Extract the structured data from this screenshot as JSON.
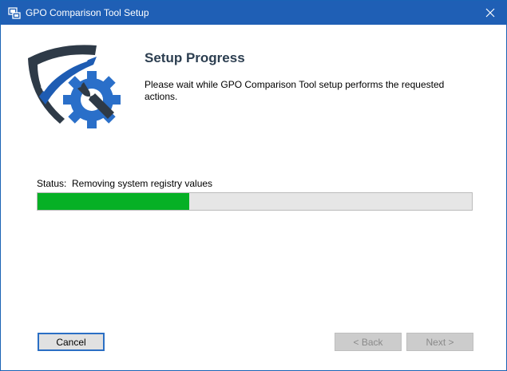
{
  "window": {
    "title": "GPO Comparison Tool Setup",
    "accent_color": "#1f5fb5"
  },
  "content": {
    "heading": "Setup Progress",
    "description": "Please wait while GPO Comparison Tool setup performs the requested actions.",
    "logo_icon": "shield-gear-wrench-icon"
  },
  "status": {
    "label": "Status:",
    "value": "Removing system registry values"
  },
  "progress": {
    "percent": 35,
    "fill_color": "#06b025"
  },
  "buttons": {
    "cancel_label": "Cancel",
    "back_label": "< Back",
    "next_label": "Next >"
  }
}
